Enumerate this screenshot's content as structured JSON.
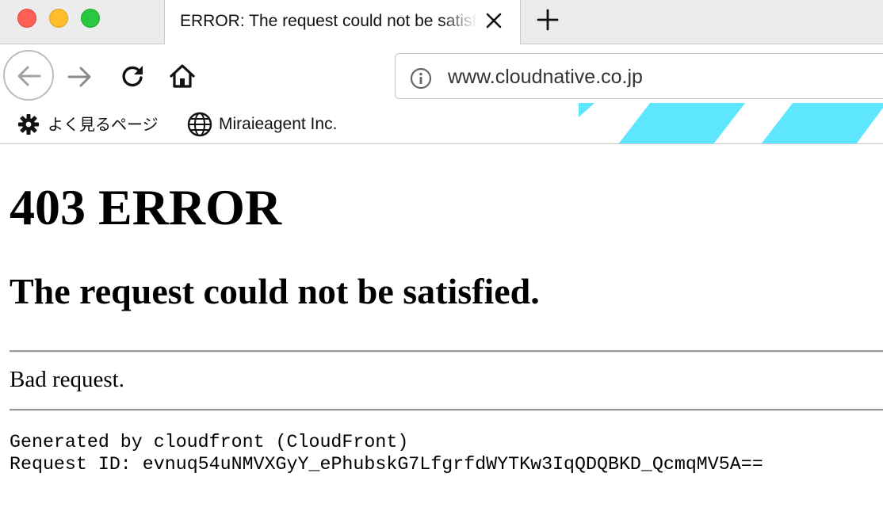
{
  "window": {
    "controls": [
      "close",
      "minimize",
      "maximize"
    ],
    "colors": {
      "close": "#ff5f57",
      "minimize": "#ffbd2e",
      "maximize": "#28c840"
    }
  },
  "tab": {
    "title": "ERROR: The request could not be satisfied",
    "close_icon": "close-icon",
    "new_tab_icon": "plus-icon"
  },
  "toolbar": {
    "back_icon": "arrow-left-icon",
    "forward_icon": "arrow-right-icon",
    "reload_icon": "reload-icon",
    "home_icon": "home-icon",
    "url": "www.cloudnative.co.jp",
    "site_info_icon": "info-icon",
    "accent_color": "#5fe6ff"
  },
  "bookmarks": [
    {
      "label": "よく見るページ",
      "icon": "gear-icon"
    },
    {
      "label": "Miraieagent Inc.",
      "icon": "globe-icon"
    }
  ],
  "page": {
    "heading": "403 ERROR",
    "subheading": "The request could not be satisfied.",
    "message": "Bad request.",
    "generated_by": "Generated by cloudfront (CloudFront)",
    "request_id_label": "Request ID:",
    "request_id": "evnuq54uNMVXGyY_ePhubskG7LfgrfdWYTKw3IqQDQBKD_QcmqMV5A=="
  }
}
